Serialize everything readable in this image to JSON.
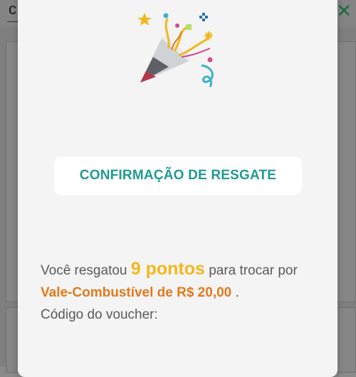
{
  "background": {
    "title_fragment": "c",
    "close_icon": "close-icon"
  },
  "modal": {
    "illustration": "party-popper-icon",
    "title": "CONFIRMAÇÃO DE RESGATE",
    "message": {
      "prefix": "Você resgatou ",
      "points": "9 pontos",
      "middle": " para trocar por ",
      "product": "Vale-Combustível de R$ 20,00",
      "suffix": " .",
      "voucher_label": "Código do voucher:"
    }
  },
  "colors": {
    "title": "#1f9a93",
    "points": "#f2b71c",
    "product": "#e07a1e",
    "close_icon": "#1b6b3f"
  }
}
